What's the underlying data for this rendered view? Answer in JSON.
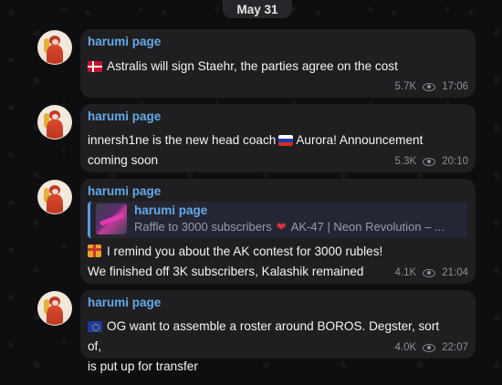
{
  "date_separator": "May 31",
  "channel_name": "harumi page",
  "messages": [
    {
      "sender": "harumi page",
      "text_line1": "Astralis will sign Staehr, the parties agree on the cost",
      "views": "5.7K",
      "time": "17:06",
      "flag_icon": "denmark-flag-icon"
    },
    {
      "sender": "harumi page",
      "text_line1a": "innersh1ne is the new head coach",
      "text_line1b": "Aurora! Announcement",
      "text_line2": "coming soon",
      "views": "5.3K",
      "time": "20:10",
      "flag_icon": "russia-flag-icon"
    },
    {
      "sender": "harumi page",
      "forward": {
        "title": "harumi page",
        "subtitle_a": "Raffle to 3000 subscribers",
        "subtitle_b": "AK-47 | Neon Revolution – ..."
      },
      "text_line1": "I remind you about the AK contest for 3000 rubles!",
      "text_line2": "We finished off 3K subscribers, Kalashik remained",
      "views": "4.1K",
      "time": "21:04",
      "gift_icon": "gift-icon"
    },
    {
      "sender": "harumi page",
      "text_line1": "OG want to assemble a roster around BOROS. Degster, sort of,",
      "text_line2": "is put up for transfer",
      "views": "4.0K",
      "time": "22:07",
      "flag_icon": "eu-flag-icon"
    }
  ],
  "colors": {
    "background": "#0e0e10",
    "bubble": "#1f1f22",
    "sender": "#65a9e8",
    "meta": "#8d8f94"
  }
}
